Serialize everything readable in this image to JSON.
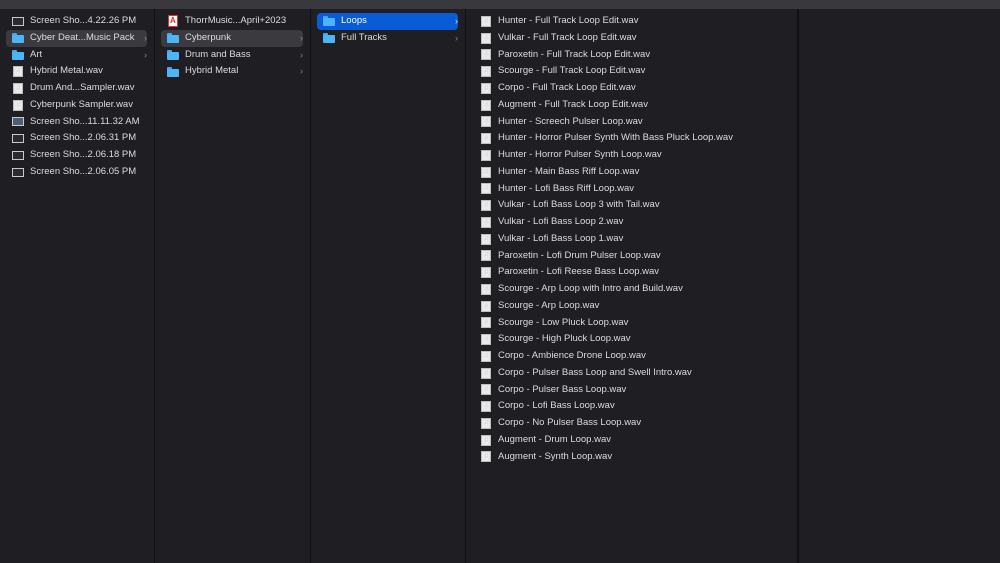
{
  "columns": [
    {
      "items": [
        {
          "label": "Screen Sho...4.22.26 PM",
          "icon": "screenshot-icon",
          "chevron": false,
          "selected": ""
        },
        {
          "label": "Cyber Deat...Music Pack",
          "icon": "folder-icon",
          "chevron": true,
          "selected": "grey"
        },
        {
          "label": "Art",
          "icon": "folder-icon",
          "chevron": true,
          "selected": ""
        },
        {
          "label": "Hybrid Metal.wav",
          "icon": "audio-file-icon",
          "chevron": false,
          "selected": ""
        },
        {
          "label": "Drum And...Sampler.wav",
          "icon": "audio-file-icon",
          "chevron": false,
          "selected": ""
        },
        {
          "label": "Cyberpunk Sampler.wav",
          "icon": "audio-file-icon",
          "chevron": false,
          "selected": ""
        },
        {
          "label": "Screen Sho...11.11.32 AM",
          "icon": "screenshot-icon",
          "chevron": false,
          "selected": ""
        },
        {
          "label": "Screen Sho...2.06.31 PM",
          "icon": "screenshot-icon",
          "chevron": false,
          "selected": ""
        },
        {
          "label": "Screen Sho...2.06.18 PM",
          "icon": "screenshot-icon",
          "chevron": false,
          "selected": ""
        },
        {
          "label": "Screen Sho...2.06.05 PM",
          "icon": "screenshot-icon",
          "chevron": false,
          "selected": ""
        }
      ]
    },
    {
      "items": [
        {
          "label": "ThorrMusic...April+2023",
          "icon": "pdf-file-icon",
          "chevron": false,
          "selected": ""
        },
        {
          "label": "Cyberpunk",
          "icon": "folder-icon",
          "chevron": true,
          "selected": "grey"
        },
        {
          "label": "Drum and Bass",
          "icon": "folder-icon",
          "chevron": true,
          "selected": ""
        },
        {
          "label": "Hybrid Metal",
          "icon": "folder-icon",
          "chevron": true,
          "selected": ""
        }
      ]
    },
    {
      "items": [
        {
          "label": "Loops",
          "icon": "folder-icon",
          "chevron": true,
          "selected": "blue"
        },
        {
          "label": "Full Tracks",
          "icon": "folder-icon",
          "chevron": true,
          "selected": ""
        }
      ]
    },
    {
      "items": [
        {
          "label": "Hunter - Full Track Loop Edit.wav",
          "icon": "audio-file-icon"
        },
        {
          "label": "Vulkar - Full Track Loop Edit.wav",
          "icon": "audio-file-icon"
        },
        {
          "label": "Paroxetin - Full Track Loop Edit.wav",
          "icon": "audio-file-icon"
        },
        {
          "label": "Scourge - Full Track Loop Edit.wav",
          "icon": "audio-file-icon"
        },
        {
          "label": "Corpo - Full Track Loop Edit.wav",
          "icon": "audio-file-icon"
        },
        {
          "label": "Augment - Full Track Loop Edit.wav",
          "icon": "audio-file-icon"
        },
        {
          "label": "Hunter - Screech Pulser Loop.wav",
          "icon": "audio-file-icon"
        },
        {
          "label": "Hunter - Horror Pulser Synth With Bass Pluck Loop.wav",
          "icon": "audio-file-icon"
        },
        {
          "label": "Hunter - Horror Pulser Synth Loop.wav",
          "icon": "audio-file-icon"
        },
        {
          "label": "Hunter - Main Bass Riff Loop.wav",
          "icon": "audio-file-icon"
        },
        {
          "label": "Hunter - Lofi Bass Riff Loop.wav",
          "icon": "audio-file-icon"
        },
        {
          "label": "Vulkar - Lofi Bass Loop 3 with Tail.wav",
          "icon": "audio-file-icon"
        },
        {
          "label": "Vulkar - Lofi Bass Loop 2.wav",
          "icon": "audio-file-icon"
        },
        {
          "label": "Vulkar - Lofi Bass Loop 1.wav",
          "icon": "audio-file-icon"
        },
        {
          "label": "Paroxetin - Lofi Drum Pulser Loop.wav",
          "icon": "audio-file-icon"
        },
        {
          "label": "Paroxetin - Lofi Reese Bass Loop.wav",
          "icon": "audio-file-icon"
        },
        {
          "label": "Scourge - Arp Loop with Intro and Build.wav",
          "icon": "audio-file-icon"
        },
        {
          "label": "Scourge - Arp Loop.wav",
          "icon": "audio-file-icon"
        },
        {
          "label": "Scourge - Low Pluck Loop.wav",
          "icon": "audio-file-icon"
        },
        {
          "label": "Scourge - High Pluck Loop.wav",
          "icon": "audio-file-icon"
        },
        {
          "label": "Corpo - Ambience Drone Loop.wav",
          "icon": "audio-file-icon"
        },
        {
          "label": "Corpo - Pulser Bass Loop and Swell Intro.wav",
          "icon": "audio-file-icon"
        },
        {
          "label": "Corpo - Pulser Bass Loop.wav",
          "icon": "audio-file-icon"
        },
        {
          "label": "Corpo - Lofi Bass Loop.wav",
          "icon": "audio-file-icon"
        },
        {
          "label": "Corpo - No Pulser Bass Loop.wav",
          "icon": "audio-file-icon"
        },
        {
          "label": "Augment - Drum Loop.wav",
          "icon": "audio-file-icon"
        },
        {
          "label": "Augment - Synth Loop.wav",
          "icon": "audio-file-icon"
        }
      ]
    }
  ],
  "chevron_glyph": "›",
  "colors": {
    "selection_blue": "#0a5bd6",
    "selection_grey": "#3b3a3f",
    "folder": "#4bb5f7",
    "background": "#1f1e23"
  }
}
